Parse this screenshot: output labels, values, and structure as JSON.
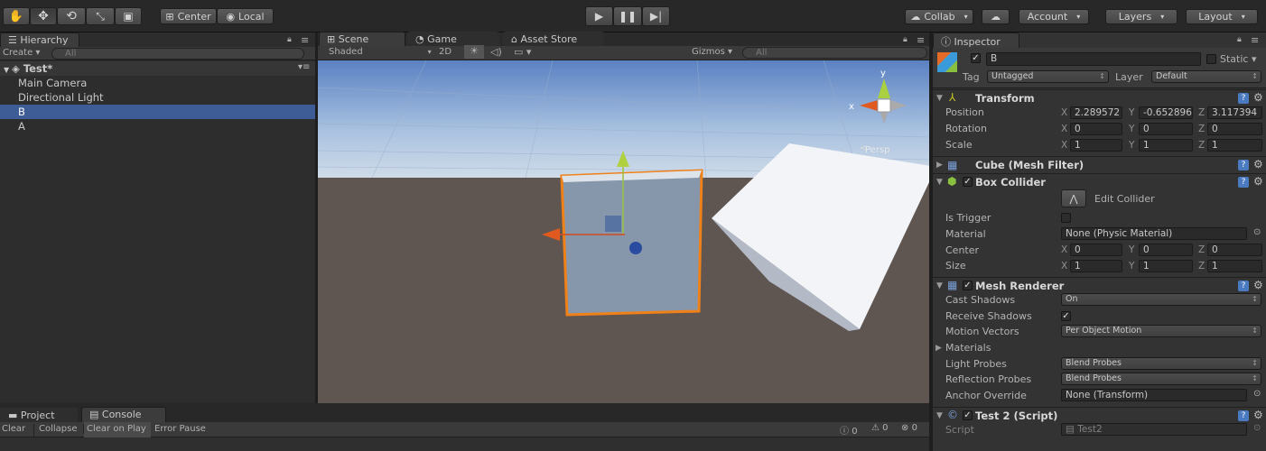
{
  "toolbar": {
    "pivot_center": "Center",
    "pivot_local": "Local",
    "collab": "Collab",
    "account": "Account",
    "layers": "Layers",
    "layout": "Layout"
  },
  "hierarchy": {
    "tab": "Hierarchy",
    "create": "Create",
    "search_placeholder": "All",
    "scene": "Test*",
    "items": [
      "Main Camera",
      "Directional Light",
      "B",
      "A"
    ],
    "selected": "B"
  },
  "scene": {
    "tabs": [
      "Scene",
      "Game",
      "Asset Store"
    ],
    "shading": "Shaded",
    "mode_2d": "2D",
    "gizmos": "Gizmos",
    "search_placeholder": "All",
    "persp": "Persp",
    "axis_x": "x",
    "axis_y": "y"
  },
  "console": {
    "tabs": [
      "Project",
      "Console"
    ],
    "buttons": [
      "Clear",
      "Collapse",
      "Clear on Play",
      "Error Pause"
    ],
    "counts": {
      "info": "0",
      "warn": "0",
      "error": "0"
    }
  },
  "inspector": {
    "tab": "Inspector",
    "name": "B",
    "static": "Static",
    "tag_label": "Tag",
    "tag": "Untagged",
    "layer_label": "Layer",
    "layer": "Default",
    "transform": {
      "title": "Transform",
      "position_label": "Position",
      "rotation_label": "Rotation",
      "scale_label": "Scale",
      "position": {
        "x": "2.289572",
        "y": "-0.652896",
        "z": "3.117394"
      },
      "rotation": {
        "x": "0",
        "y": "0",
        "z": "0"
      },
      "scale": {
        "x": "1",
        "y": "1",
        "z": "1"
      }
    },
    "mesh_filter": {
      "title": "Cube (Mesh Filter)"
    },
    "box_collider": {
      "title": "Box Collider",
      "edit": "Edit Collider",
      "is_trigger_label": "Is Trigger",
      "material_label": "Material",
      "material": "None (Physic Material)",
      "center_label": "Center",
      "size_label": "Size",
      "center": {
        "x": "0",
        "y": "0",
        "z": "0"
      },
      "size": {
        "x": "1",
        "y": "1",
        "z": "1"
      }
    },
    "mesh_renderer": {
      "title": "Mesh Renderer",
      "cast_shadows_label": "Cast Shadows",
      "cast_shadows": "On",
      "receive_shadows_label": "Receive Shadows",
      "motion_vectors_label": "Motion Vectors",
      "motion_vectors": "Per Object Motion",
      "materials_label": "Materials",
      "light_probes_label": "Light Probes",
      "light_probes": "Blend Probes",
      "reflection_probes_label": "Reflection Probes",
      "reflection_probes": "Blend Probes",
      "anchor_override_label": "Anchor Override",
      "anchor_override": "None (Transform)"
    },
    "script": {
      "title": "Test 2 (Script)",
      "label": "Script",
      "value": "Test2"
    },
    "axes": {
      "x": "X",
      "y": "Y",
      "z": "Z"
    }
  }
}
